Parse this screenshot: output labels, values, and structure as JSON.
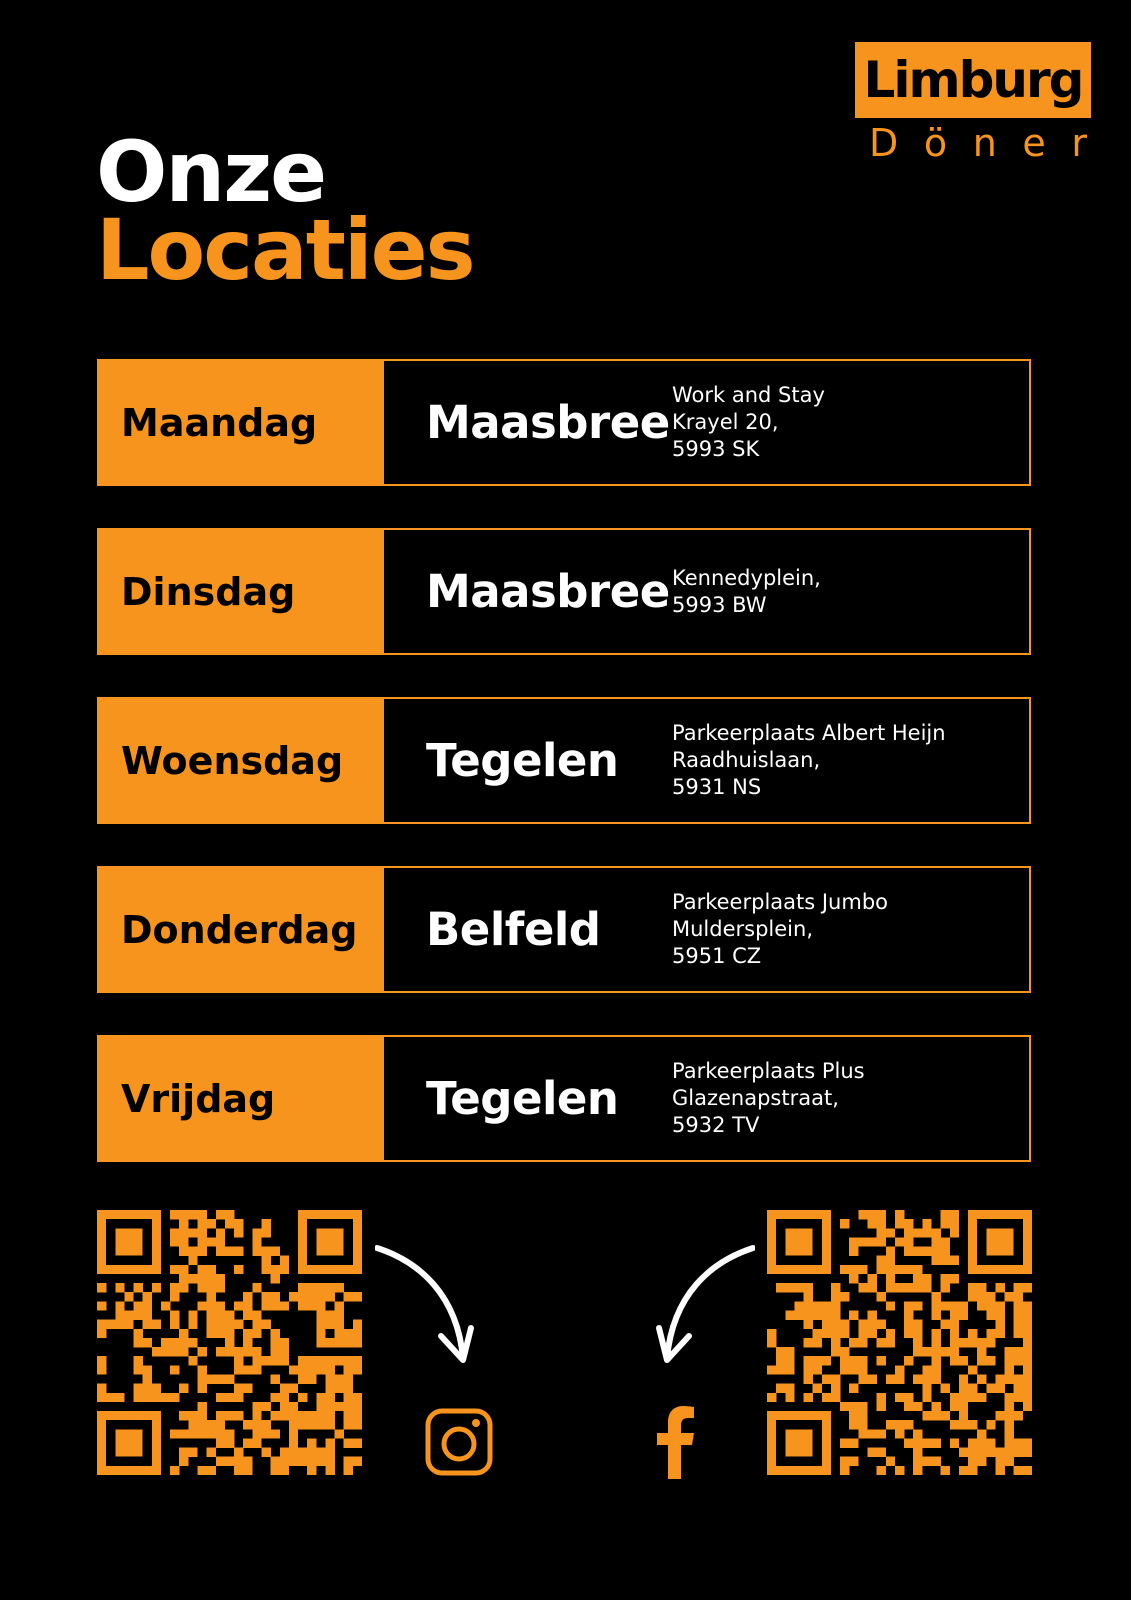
{
  "logo": {
    "name": "Limburg",
    "sub_letters": [
      "D",
      "ö",
      "n",
      "e",
      "r"
    ]
  },
  "title": {
    "line1": "Onze",
    "line2": "Locaties"
  },
  "locations": [
    {
      "day": "Maandag",
      "city": "Maasbree",
      "address": [
        "Work and Stay",
        "Krayel 20,",
        "5993 SK"
      ]
    },
    {
      "day": "Dinsdag",
      "city": "Maasbree",
      "address": [
        "Kennedyplein,",
        "5993 BW"
      ]
    },
    {
      "day": "Woensdag",
      "city": "Tegelen",
      "address": [
        "Parkeerplaats Albert Heijn",
        "Raadhuislaan,",
        "5931 NS"
      ]
    },
    {
      "day": "Donderdag",
      "city": "Belfeld",
      "address": [
        "Parkeerplaats Jumbo",
        "Muldersplein,",
        "5951 CZ"
      ]
    },
    {
      "day": "Vrijdag",
      "city": "Tegelen",
      "address": [
        "Parkeerplaats Plus",
        "Glazenapstraat,",
        "5932 TV"
      ]
    }
  ],
  "social": [
    {
      "icon": "instagram-icon"
    },
    {
      "icon": "facebook-icon"
    }
  ],
  "colors": {
    "accent": "#F7941D",
    "background": "#000000",
    "text": "#FFFFFF"
  }
}
